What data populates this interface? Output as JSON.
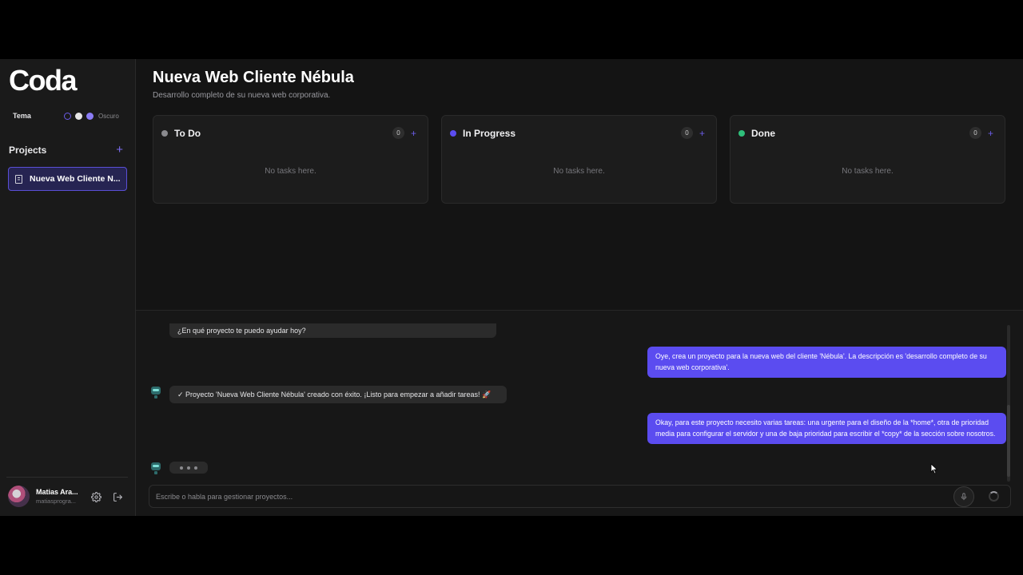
{
  "sidebar": {
    "logo": "Coda",
    "theme_label": "Tema",
    "theme_mode": "Oscuro",
    "projects_title": "Projects",
    "projects": [
      {
        "name": "Nueva Web Cliente N..."
      }
    ],
    "user": {
      "name": "Matias Ara...",
      "email": "matiasprogra..."
    }
  },
  "project": {
    "title": "Nueva Web Cliente Nébula",
    "description": "Desarrollo completo de su nueva web corporativa."
  },
  "columns": [
    {
      "title": "To Do",
      "count": "0",
      "empty": "No tasks here.",
      "color": "#8a8a8e"
    },
    {
      "title": "In Progress",
      "count": "0",
      "empty": "No tasks here.",
      "color": "#5b4cf0"
    },
    {
      "title": "Done",
      "count": "0",
      "empty": "No tasks here.",
      "color": "#2fbf7a"
    }
  ],
  "chat": {
    "messages": [
      {
        "role": "assistant",
        "text": "¿En qué proyecto te puedo ayudar hoy?"
      },
      {
        "role": "user",
        "text": "Oye, crea un proyecto para la nueva web del cliente 'Nébula'. La descripción es 'desarrollo completo de su nueva web corporativa'."
      },
      {
        "role": "assistant",
        "text": "✓ Proyecto 'Nueva Web Cliente Nébula' creado con éxito. ¡Listo para empezar a añadir tareas! 🚀"
      },
      {
        "role": "user",
        "text": "Okay, para este proyecto necesito varias tareas: una urgente para el diseño de la *home*, otra de prioridad media para configurar el servidor y una de baja prioridad para escribir el *copy* de la sección sobre nosotros."
      }
    ],
    "input_placeholder": "Escribe o habla para gestionar proyectos..."
  },
  "colors": {
    "accent": "#5b4cf0",
    "background": "#141414",
    "sidebar": "#1a1a1a"
  }
}
